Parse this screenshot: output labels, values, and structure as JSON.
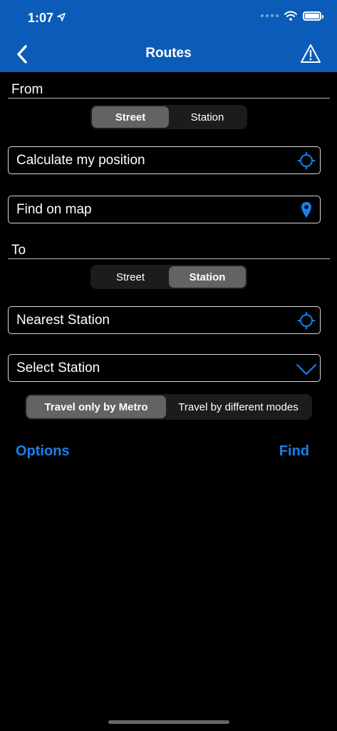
{
  "status_bar": {
    "time": "1:07"
  },
  "header": {
    "title": "Routes"
  },
  "from": {
    "label": "From",
    "segments": [
      "Street",
      "Station"
    ],
    "selected": "Street",
    "fields": [
      "Calculate my position",
      "Find on map"
    ]
  },
  "to": {
    "label": "To",
    "segments": [
      "Street",
      "Station"
    ],
    "selected": "Station",
    "fields": [
      "Nearest Station",
      "Select Station"
    ]
  },
  "travel_mode": {
    "segments": [
      "Travel only by Metro",
      "Travel by different modes"
    ],
    "selected": "Travel only by Metro"
  },
  "actions": {
    "options": "Options",
    "find": "Find"
  },
  "colors": {
    "header_bg": "#0b5cb8",
    "accent": "#1a7fe8",
    "background": "#000000"
  }
}
